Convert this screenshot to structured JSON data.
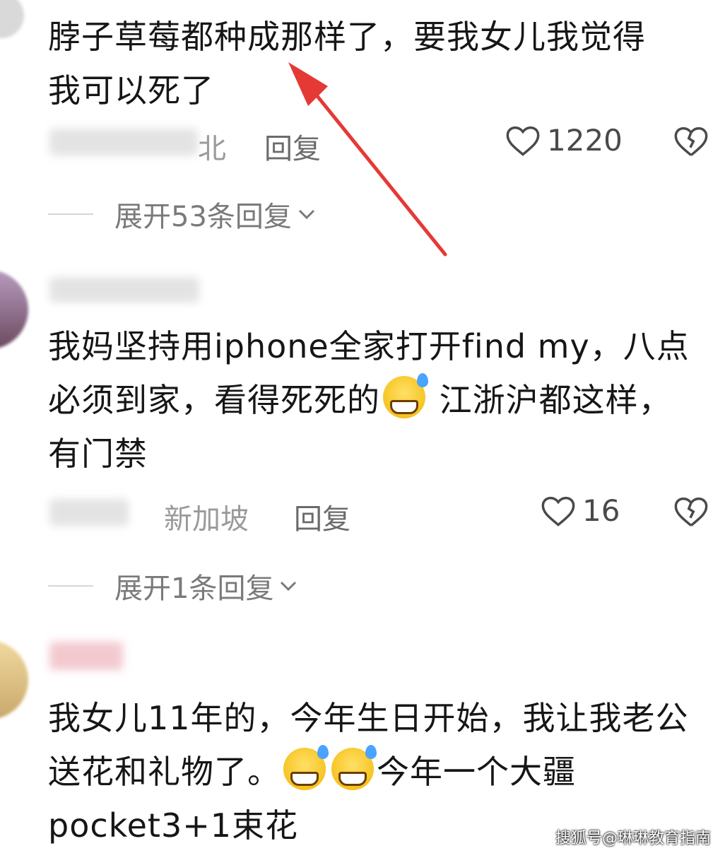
{
  "comments": [
    {
      "text_line1": "脖子草莓都种成那样了，要我女儿我觉得",
      "text_line2": "我可以死了",
      "location": "北",
      "reply_label": "回复",
      "likes": "1220",
      "expand_label": "展开53条回复"
    },
    {
      "text_line1": "我妈坚持用iphone全家打开find my，八点",
      "text_line2a": "必须到家，看得死死的",
      "text_line2b": " 江浙沪都这样，",
      "text_line3": "有门禁",
      "location": "新加坡",
      "reply_label": "回复",
      "likes": "16",
      "expand_label": "展开1条回复"
    },
    {
      "text_line1": "我女儿11年的，今年生日开始，我让我老公",
      "text_line2a": "送花和礼物了。",
      "text_line2b": "今年一个大疆",
      "text_line3": "pocket3+1束花"
    }
  ],
  "watermark": "搜狐号@琳琳教育指南",
  "colors": {
    "arrow": "#e53935",
    "emoji": "#f2b705"
  }
}
